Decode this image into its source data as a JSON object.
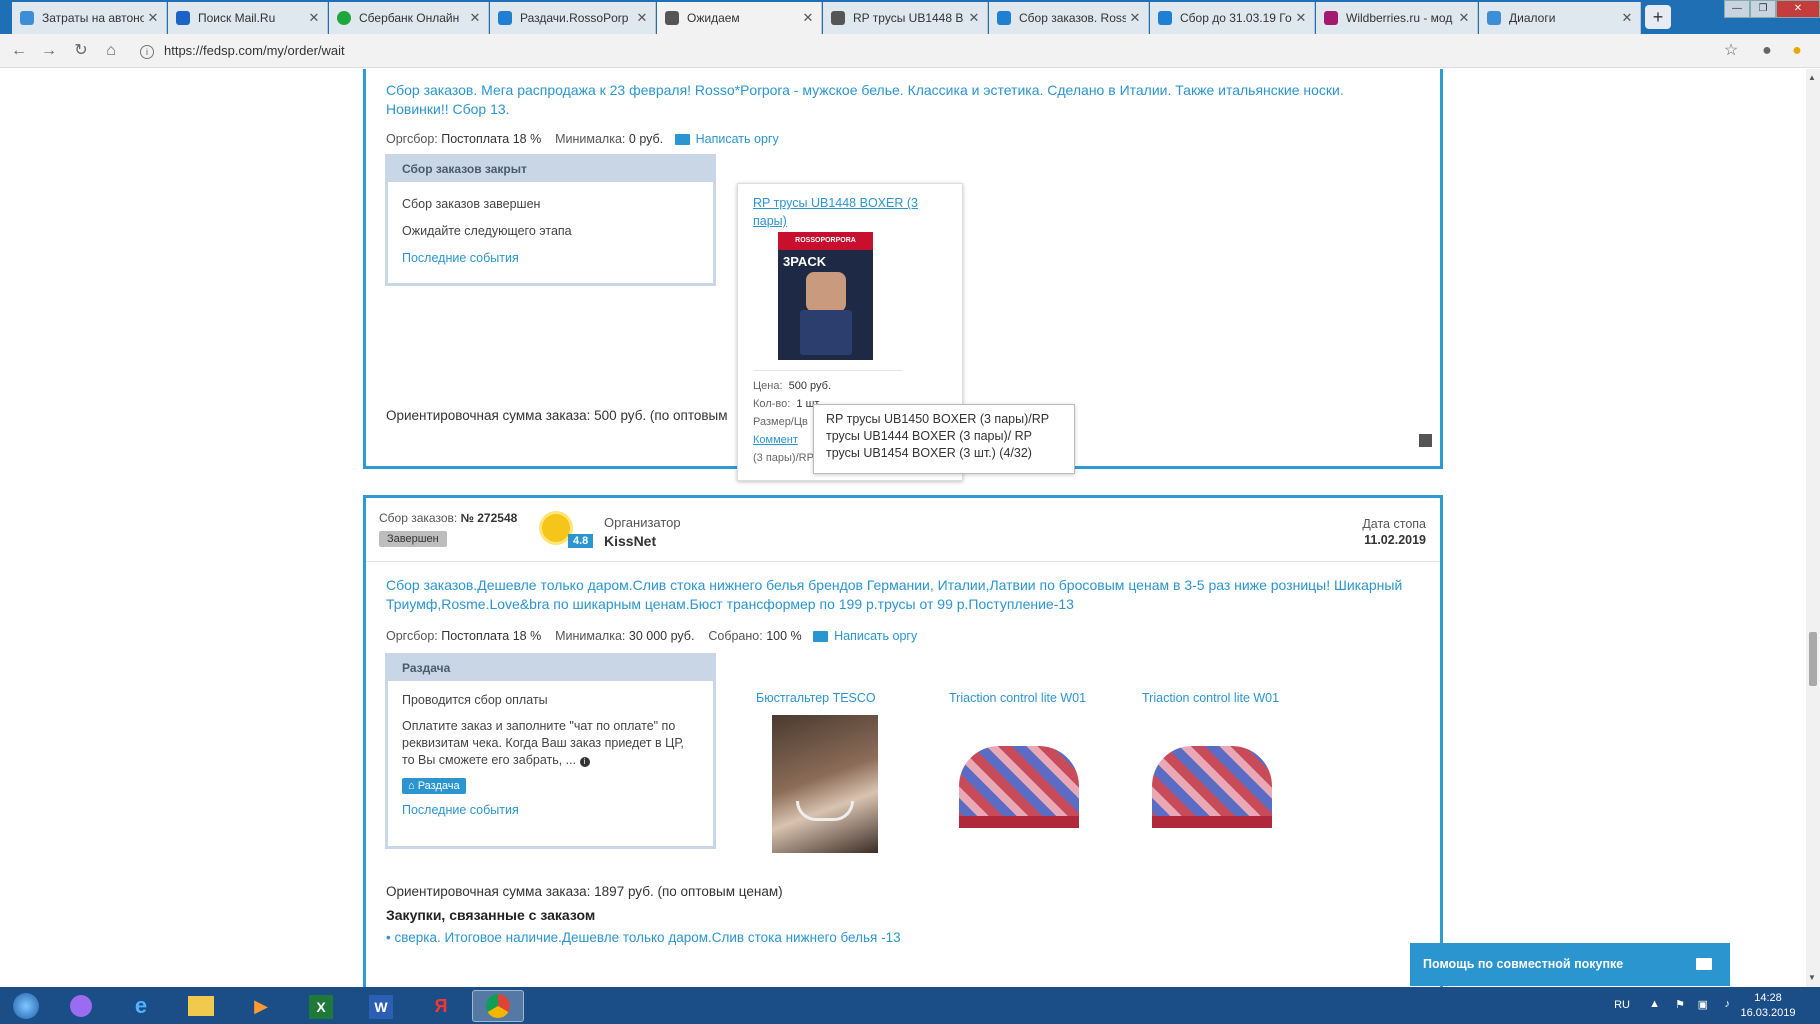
{
  "browser": {
    "tabs": [
      {
        "label": "Затраты на автоно",
        "color": "#3c8fd6"
      },
      {
        "label": "Поиск Mail.Ru",
        "color": "#1d63c6"
      },
      {
        "label": "Сбербанк Онлайн",
        "color": "#1ea83c"
      },
      {
        "label": "Раздачи.RossoPorp",
        "color": "#1f7fd0"
      },
      {
        "label": "Ожидаем",
        "color": "#555555"
      },
      {
        "label": "RP трусы UB1448 B",
        "color": "#555555"
      },
      {
        "label": "Сбор заказов. Ross",
        "color": "#1f7fd0"
      },
      {
        "label": "Сбор до 31.03.19 Го",
        "color": "#1f7fd0"
      },
      {
        "label": "Wildberries.ru - мод",
        "color": "#a3196f"
      },
      {
        "label": "Диалоги",
        "color": "#3c8fd6"
      }
    ],
    "new_tab": "+",
    "url": "https://fedsp.com/my/order/wait"
  },
  "order1": {
    "description": "Сбор заказов. Мега распродажа к 23 февраля! Rosso*Porpora - мужское белье. Классика и эстетика. Сделано в Италии. Также итальянские носки. Новинки!! Сбор 13.",
    "fee_label": "Оргсбор:",
    "fee_value": "Постоплата 18 %",
    "min_label": "Минималка:",
    "min_value": "0 руб.",
    "write_org": "Написать оргу",
    "status_head": "Сбор заказов закрыт",
    "status_line1": "Сбор заказов завершен",
    "status_line2": "Ожидайте следующего этапа",
    "recent_events": "Последние события",
    "total": "Ориентировочная сумма заказа: 500 руб. (по оптовым",
    "product": {
      "title": "RP трусы UB1448 BOXER (3 пары)",
      "price_label": "Цена:",
      "price_value": "500 руб.",
      "qty_label": "Кол-во:",
      "qty_value": "1 шт.",
      "size_label": "Размер/Цв",
      "comment_label": "Коммент",
      "comment_tail": "(3 пары)/RP",
      "image_brand": "ROSSOPORPORA",
      "image_pack": "3PACK"
    },
    "tooltip": "RP трусы UB1450 BOXER (3 пары)/RP трусы UB1444 BOXER (3 пары)/ RP трусы UB1454 BOXER (3 шт.) (4/32)"
  },
  "order2": {
    "number_label": "Сбор заказов:",
    "number_value": "№ 272548",
    "state_badge": "Завершен",
    "rating": "4.8",
    "organizer_label": "Организатор",
    "organizer_name": "KissNet",
    "stop_date_label": "Дата стопа",
    "stop_date_value": "11.02.2019",
    "description": "Сбор заказов.Дешевле только даром.Слив стока нижнего белья брендов Германии, Италии,Латвии по бросовым ценам в 3-5 раз ниже розницы! Шикарный Триумф,Rosme.Love&bra по шикарным ценам.Бюст трансформер по 199 р.трусы от 99 р.Поступление-13",
    "fee_label": "Оргсбор:",
    "fee_value": "Постоплата 18 %",
    "min_label": "Минималка:",
    "min_value": "30 000 руб.",
    "collected_label": "Собрано:",
    "collected_value": "100 %",
    "write_org": "Написать оргу",
    "status_head": "Раздача",
    "status_line1": "Проводится сбор оплаты",
    "status_line2": "Оплатите заказ и заполните \"чат по оплате\" по",
    "status_line3": "реквизитам чека. Когда Ваш заказ приедет в ЦР,",
    "status_line4": "то Вы сможете его забрать, ...",
    "dispatch_button": "Раздача",
    "recent_events": "Последние события",
    "products": [
      "Бюстгальтер TESCO",
      "Triaction control lite W01",
      "Triaction control lite W01"
    ],
    "total": "Ориентировочная сумма заказа: 1897 руб. (по оптовым ценам)",
    "related_title": "Закупки, связанные с заказом",
    "related_item": "сверка. Итоговое наличие.Дешевле только даром.Слив стока нижнего белья -13"
  },
  "help_widget": "Помощь по совместной покупке",
  "taskbar": {
    "lang": "RU",
    "time": "14:28",
    "date": "16.03.2019"
  }
}
